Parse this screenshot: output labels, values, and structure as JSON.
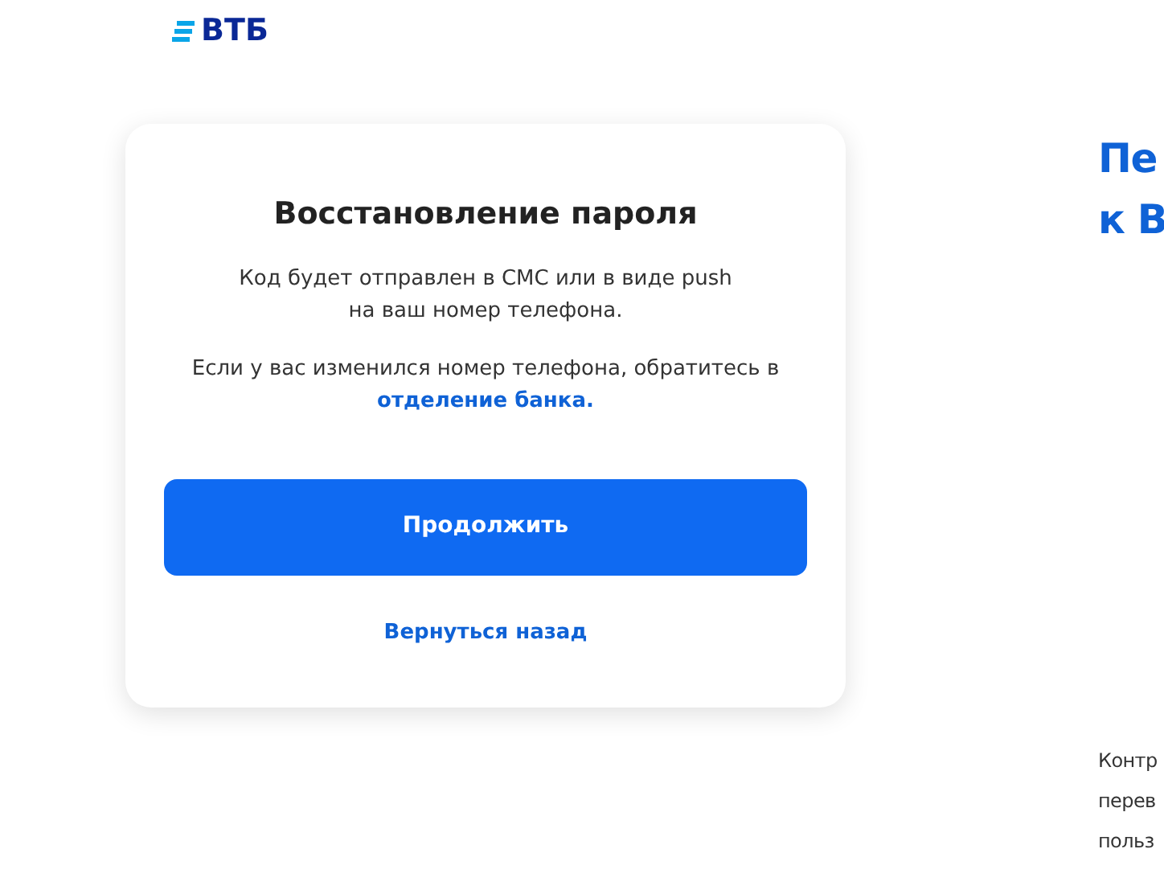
{
  "logo": {
    "text": "ВТБ"
  },
  "card": {
    "title": "Восстановление пароля",
    "notice": "Код будет отправлен в СМС или в виде push\nна ваш номер телефона.",
    "hint": "Если у вас изменился номер телефона, обратитесь в",
    "hint_link": "отделение банка.",
    "primary_button": "Продолжить",
    "back_link": "Вернуться назад"
  },
  "side": {
    "heading_lines": [
      "Пе",
      "к В"
    ],
    "text_lines": [
      "Контр",
      "перев",
      "польз"
    ]
  }
}
